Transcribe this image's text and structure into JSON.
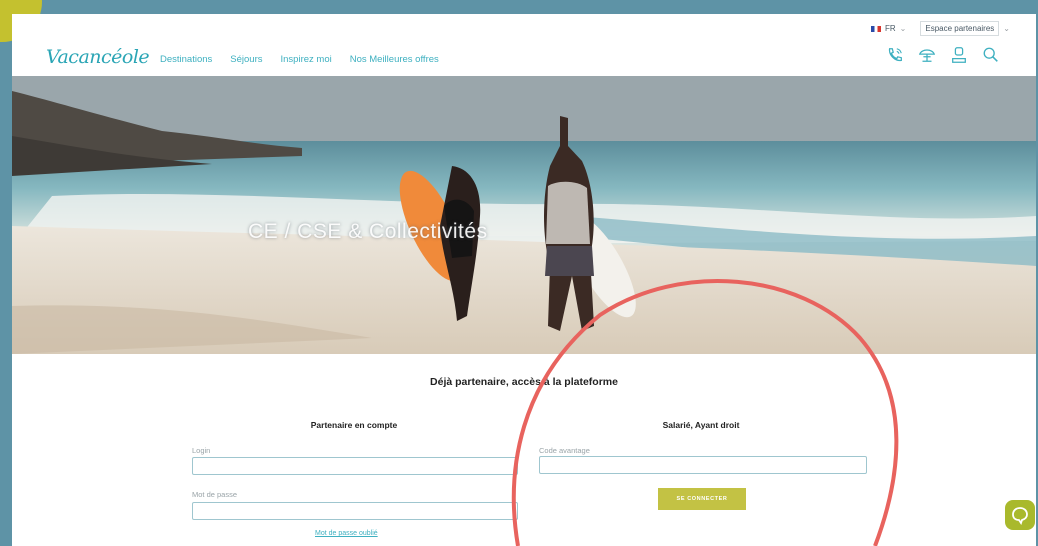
{
  "header": {
    "language": "FR",
    "partner_space": "Espace partenaires",
    "logo_text": "Vacancéole",
    "nav": [
      "Destinations",
      "Séjours",
      "Inspirez moi",
      "Nos Meilleures offres"
    ]
  },
  "hero": {
    "title": "CE / CSE & Collectivités"
  },
  "login": {
    "section_title": "Déjà partenaire, accès à la plateforme",
    "partner_account": {
      "title": "Partenaire en compte",
      "login_label": "Login",
      "login_value": "",
      "password_label": "Mot de passe",
      "password_value": "",
      "forgot_link": "Mot de passe oublié"
    },
    "employee": {
      "title": "Salarié, Ayant droit",
      "code_label": "Code avantage",
      "code_value": "",
      "connect_button": "SE CONNECTER"
    }
  },
  "colors": {
    "frame_border": "#5e93a6",
    "brand_teal": "#3eb0c0",
    "button_green": "#c3c244",
    "annotation_circle": "#e8635e"
  },
  "icons": [
    "phone-icon",
    "parasol-icon",
    "user-icon",
    "search-icon",
    "chat-icon"
  ]
}
